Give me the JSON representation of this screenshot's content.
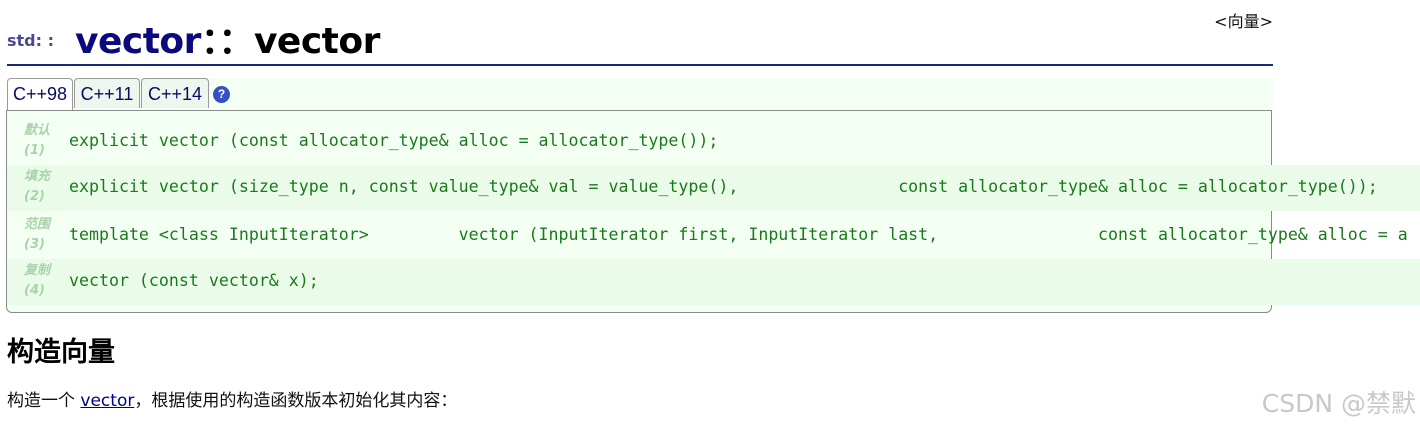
{
  "header": {
    "namespace": "std: :",
    "class_name": "vector",
    "separator": "：：",
    "function_name": "vector",
    "type_tag": "<向量>"
  },
  "tabs": [
    {
      "label": "C++98",
      "active": true
    },
    {
      "label": "C++11",
      "active": false
    },
    {
      "label": "C++14",
      "active": false
    }
  ],
  "help_icon": "?",
  "declarations": [
    {
      "label": "默认",
      "number": "(1)",
      "code": "explicit vector (const allocator_type& alloc = allocator_type());"
    },
    {
      "label": "填充",
      "number": "(2)",
      "code": "explicit vector (size_type n, const value_type& val = value_type(),                const allocator_type& alloc = allocator_type());"
    },
    {
      "label": "范围",
      "number": "(3)",
      "code": "template <class InputIterator>         vector (InputIterator first, InputIterator last,                const allocator_type& alloc = a"
    },
    {
      "label": "复制",
      "number": "(4)",
      "code": "vector (const vector& x);"
    }
  ],
  "section": {
    "title": "构造向量",
    "text_before": "构造一个 ",
    "link": "vector",
    "text_after": "，根据使用的构造函数版本初始化其内容："
  },
  "watermark": "CSDN @禁默"
}
